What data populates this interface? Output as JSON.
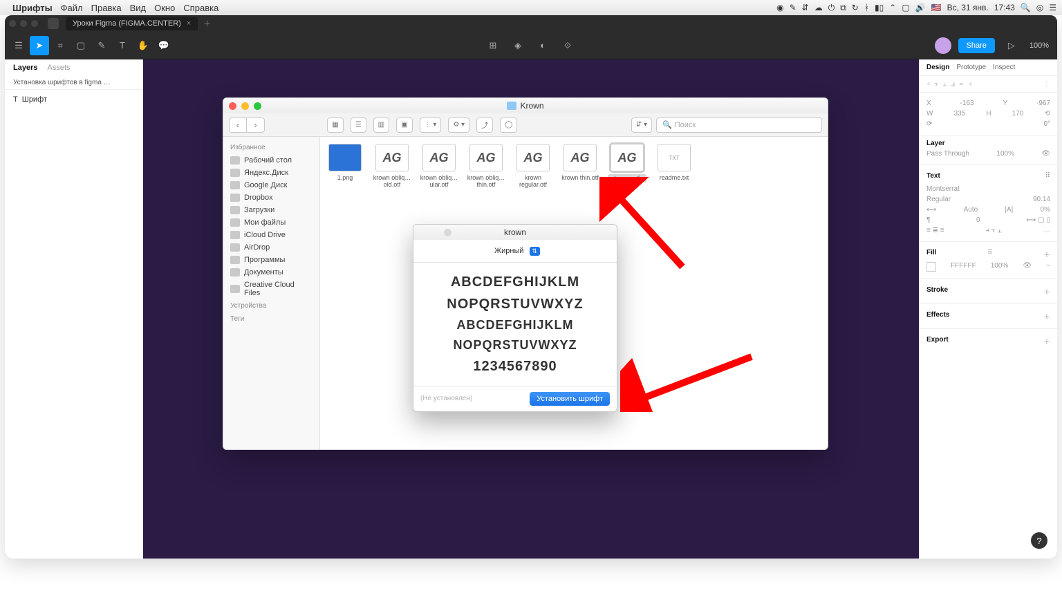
{
  "menubar": {
    "app": "Шрифты",
    "items": [
      "Файл",
      "Правка",
      "Вид",
      "Окно",
      "Справка"
    ],
    "date": "Вс, 31 янв.",
    "time": "17:43"
  },
  "figma": {
    "tab": "Уроки Figma (FIGMA.CENTER)",
    "share": "Share",
    "zoom": "100%",
    "left": {
      "tabs": [
        "Layers",
        "Assets"
      ],
      "page": "Установка шрифтов в figma …",
      "layer": "Шрифт"
    },
    "right": {
      "tabs": [
        "Design",
        "Prototype",
        "Inspect"
      ],
      "x": "-163",
      "y": "-967",
      "w": "335",
      "h": "170",
      "rot": "0°",
      "layerTitle": "Layer",
      "passThrough": "Pass Through",
      "opacity": "100%",
      "textTitle": "Text",
      "fontFamily": "Montserrat",
      "fontWeight": "Regular",
      "fontSize": "90.14",
      "lineHeight": "Auto",
      "letterSpacing": "0%",
      "paraSpacing": "0",
      "fillTitle": "Fill",
      "fillHex": "FFFFFF",
      "fillOpacity": "100%",
      "strokeTitle": "Stroke",
      "effectsTitle": "Effects",
      "exportTitle": "Export"
    }
  },
  "finder": {
    "title": "Krown",
    "searchPlaceholder": "Поиск",
    "side": {
      "favHeader": "Избранное",
      "items": [
        "Рабочий стол",
        "Яндекс.Диск",
        "Google Диск",
        "Dropbox",
        "Загрузки",
        "Мои файлы",
        "iCloud Drive",
        "AirDrop",
        "Программы",
        "Документы",
        "Creative Cloud Files"
      ],
      "devices": "Устройства",
      "tags": "Теги"
    },
    "files": [
      {
        "name": "1.png",
        "kind": "png"
      },
      {
        "name": "krown obliq…old.otf",
        "kind": "ag"
      },
      {
        "name": "krown obliq…ular.otf",
        "kind": "ag"
      },
      {
        "name": "krown obliq…thin.otf",
        "kind": "ag"
      },
      {
        "name": "krown regular.otf",
        "kind": "ag"
      },
      {
        "name": "krown thin.otf",
        "kind": "ag"
      },
      {
        "name": "krown.otf",
        "kind": "ag",
        "selected": true
      },
      {
        "name": "readme.txt",
        "kind": "txt"
      }
    ]
  },
  "fontbook": {
    "title": "krown",
    "weight": "Жирный",
    "preview": {
      "l1": "ABCDEFGHIJKLM",
      "l2": "NOPQRSTUVWXYZ",
      "l3": "ABCDEFGHIJKLM",
      "l4": "NOPQRSTUVWXYZ",
      "l5": "1234567890"
    },
    "status": "(Не установлен)",
    "install": "Установить шрифт"
  }
}
